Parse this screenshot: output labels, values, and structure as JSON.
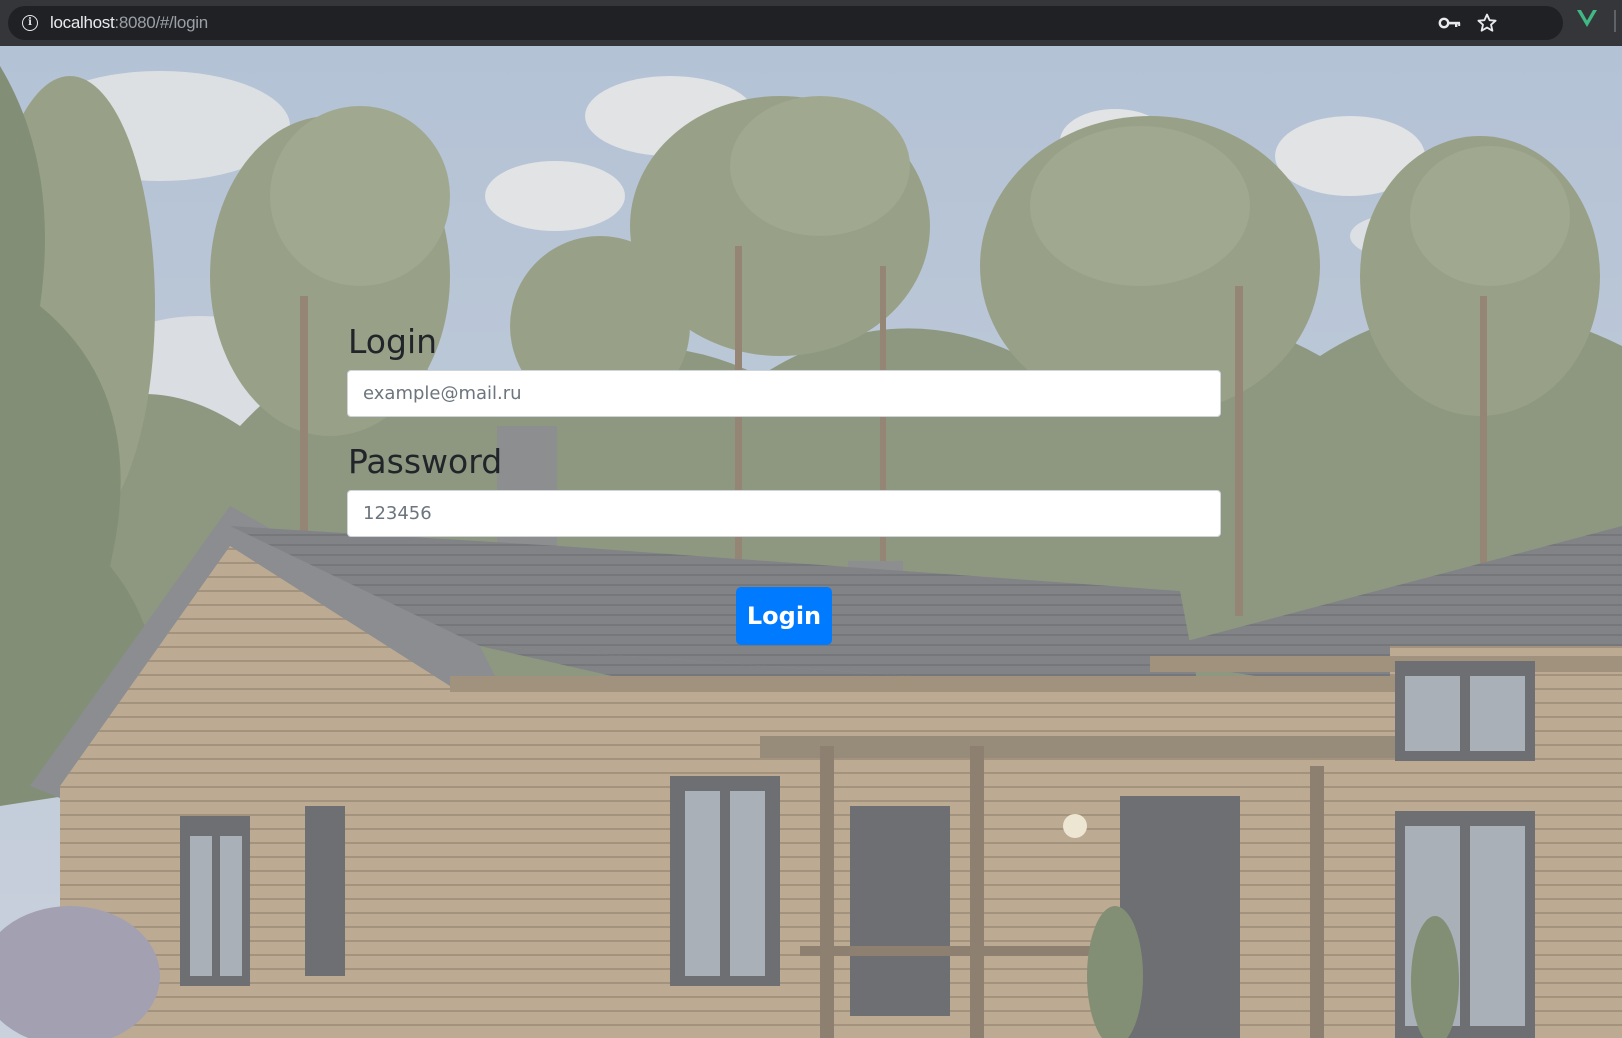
{
  "browser": {
    "url_host": "localhost",
    "url_path": ":8080/#/login",
    "info_icon": "info-icon",
    "key_icon": "key-icon",
    "star_icon": "star-icon",
    "extension_icon": "vue-extension-icon",
    "extension_color": "#41b883"
  },
  "form": {
    "login_label": "Login",
    "login_placeholder": "example@mail.ru",
    "password_label": "Password",
    "password_placeholder": "123456",
    "submit_label": "Login"
  },
  "colors": {
    "primary": "#007bff",
    "chrome": "#35363a",
    "omnibox": "#202124"
  }
}
